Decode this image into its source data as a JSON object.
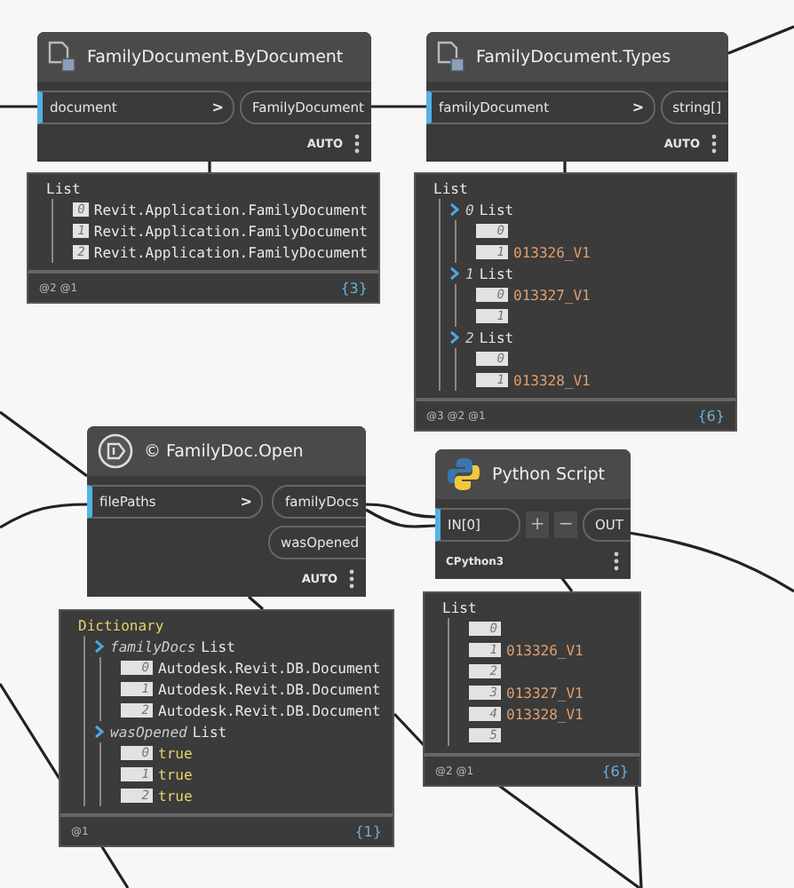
{
  "nodes": [
    {
      "title": "FamilyDocument.ByDocument",
      "inputs": [
        {
          "name": "document",
          "chevron": ">"
        }
      ],
      "outputs": [
        {
          "name": "FamilyDocument"
        }
      ],
      "run_mode": "AUTO",
      "preview": {
        "header": "List",
        "rows": [
          {
            "index": "0",
            "value": "Revit.Application.FamilyDocument",
            "kind": "object"
          },
          {
            "index": "1",
            "value": "Revit.Application.FamilyDocument",
            "kind": "object"
          },
          {
            "index": "2",
            "value": "Revit.Application.FamilyDocument",
            "kind": "object"
          }
        ],
        "levels": "@2 @1",
        "count": "{3}"
      }
    },
    {
      "title": "FamilyDocument.Types",
      "inputs": [
        {
          "name": "familyDocument",
          "chevron": ">"
        }
      ],
      "outputs": [
        {
          "name": "string[]"
        }
      ],
      "run_mode": "AUTO",
      "preview": {
        "header": "List",
        "rows": [
          {
            "index": "0",
            "label": "List",
            "children": [
              {
                "index": "0"
              },
              {
                "index": "1",
                "value": "013326_V1",
                "kind": "string"
              }
            ]
          },
          {
            "index": "1",
            "label": "List",
            "children": [
              {
                "index": "0",
                "value": "013327_V1",
                "kind": "string"
              },
              {
                "index": "1"
              }
            ]
          },
          {
            "index": "2",
            "label": "List",
            "children": [
              {
                "index": "0"
              },
              {
                "index": "1",
                "value": "013328_V1",
                "kind": "string"
              }
            ]
          }
        ],
        "levels": "@3 @2 @1",
        "count": "{6}"
      }
    },
    {
      "title": "© FamilyDoc.Open",
      "inputs": [
        {
          "name": "filePaths",
          "chevron": ">"
        }
      ],
      "outputs": [
        {
          "name": "familyDocs"
        },
        {
          "name": "wasOpened"
        }
      ],
      "run_mode": "AUTO",
      "preview": {
        "header": "Dictionary",
        "rows": [
          {
            "key": "familyDocs",
            "label": "List",
            "children": [
              {
                "index": "0",
                "value": "Autodesk.Revit.DB.Document",
                "kind": "object"
              },
              {
                "index": "1",
                "value": "Autodesk.Revit.DB.Document",
                "kind": "object"
              },
              {
                "index": "2",
                "value": "Autodesk.Revit.DB.Document",
                "kind": "object"
              }
            ]
          },
          {
            "key": "wasOpened",
            "label": "List",
            "children": [
              {
                "index": "0",
                "value": "true",
                "kind": "bool"
              },
              {
                "index": "1",
                "value": "true",
                "kind": "bool"
              },
              {
                "index": "2",
                "value": "true",
                "kind": "bool"
              }
            ]
          }
        ],
        "levels": "@1",
        "count": "{1}"
      }
    },
    {
      "title": "Python Script",
      "inputs": [
        {
          "name": "IN[0]"
        }
      ],
      "controls": [
        "+",
        "−"
      ],
      "outputs": [
        {
          "name": "OUT"
        }
      ],
      "engine": "CPython3",
      "preview": {
        "header": "List",
        "rows": [
          {
            "index": "0"
          },
          {
            "index": "1",
            "value": "013326_V1",
            "kind": "string"
          },
          {
            "index": "2"
          },
          {
            "index": "3",
            "value": "013327_V1",
            "kind": "string"
          },
          {
            "index": "4",
            "value": "013328_V1",
            "kind": "string"
          },
          {
            "index": "5"
          }
        ],
        "levels": "@2 @1",
        "count": "{6}"
      }
    }
  ]
}
